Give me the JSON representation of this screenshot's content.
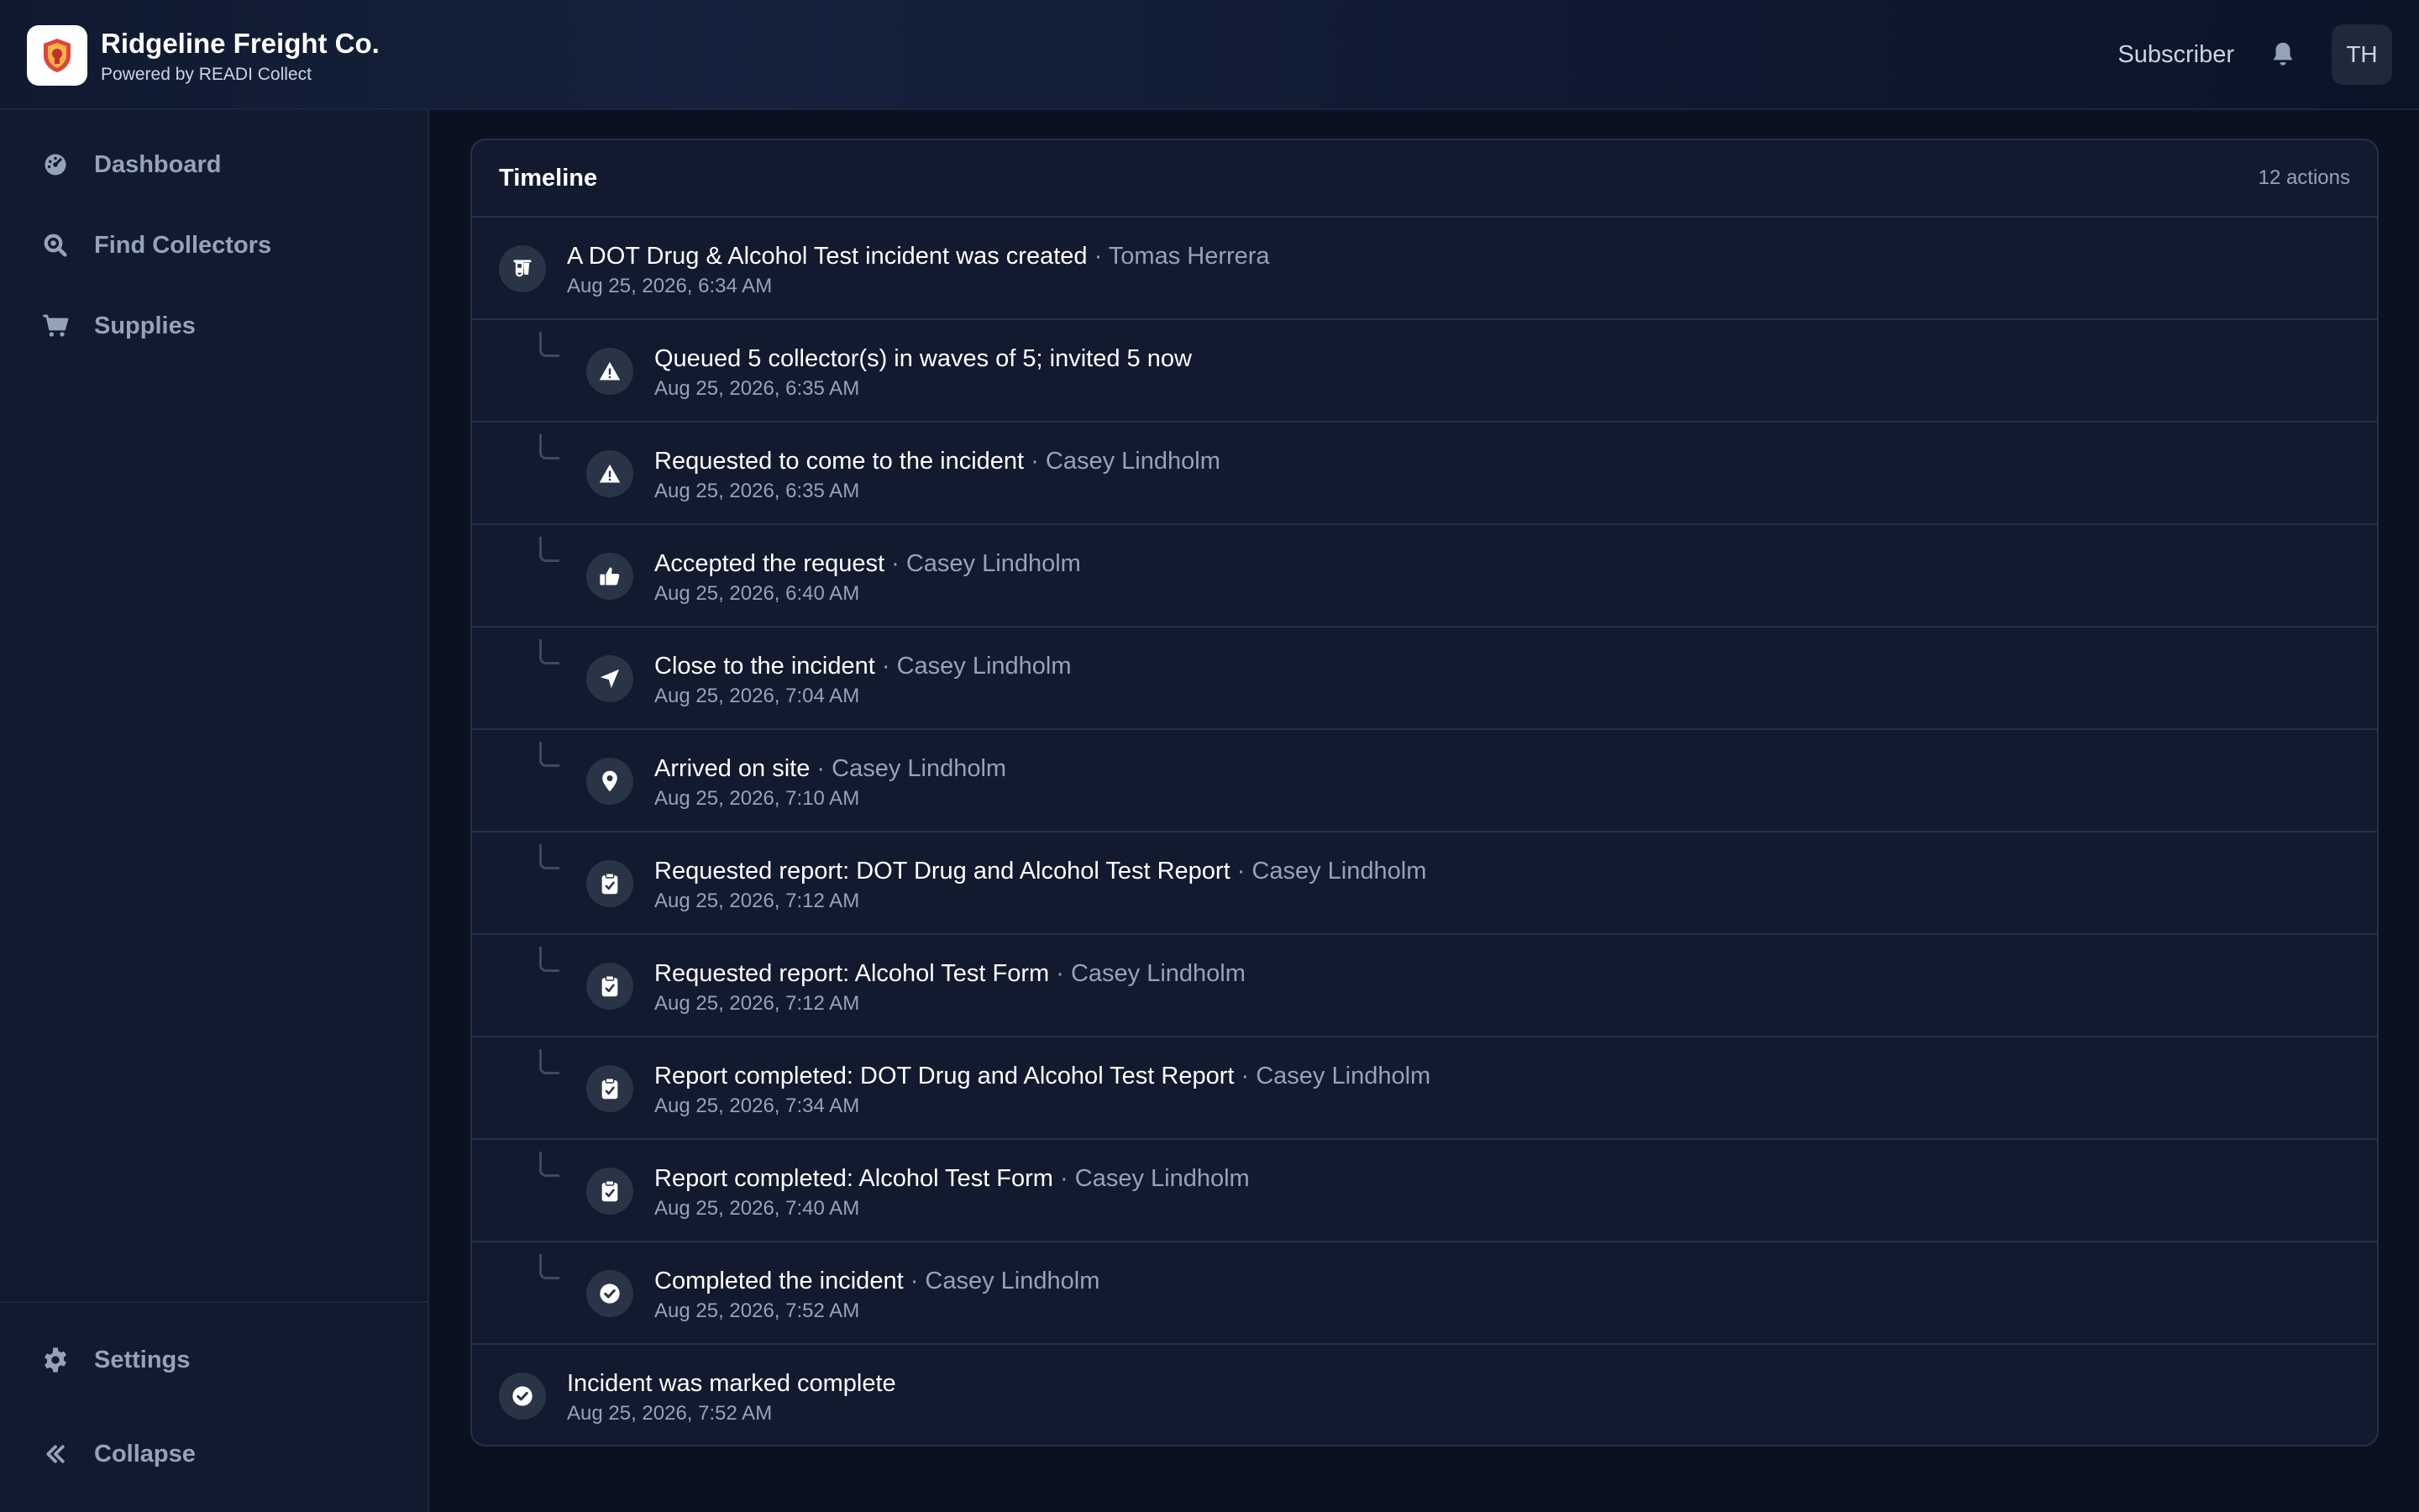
{
  "brand": {
    "name": "Ridgeline Freight Co.",
    "subtitle": "Powered by READI Collect",
    "logo_icon": "shield-badge-icon"
  },
  "header": {
    "role": "Subscriber",
    "avatar_initials": "TH",
    "bell_icon": "bell-icon"
  },
  "sidebar": {
    "items": [
      {
        "label": "Dashboard",
        "icon": "gauge-icon"
      },
      {
        "label": "Find Collectors",
        "icon": "search-icon"
      },
      {
        "label": "Supplies",
        "icon": "cart-icon"
      }
    ],
    "footer": [
      {
        "label": "Settings",
        "icon": "gear-icon"
      },
      {
        "label": "Collapse",
        "icon": "double-chevron-left-icon"
      }
    ]
  },
  "timeline": {
    "title": "Timeline",
    "count": "12 actions",
    "rows": [
      {
        "level": "top",
        "icon": "test-kit-icon",
        "text": "A DOT Drug & Alcohol Test incident was created",
        "actor": "Tomas Herrera",
        "time": "Aug 25, 2026, 6:34 AM"
      },
      {
        "level": "child",
        "icon": "warning-icon",
        "text": "Queued 5 collector(s) in waves of 5; invited 5 now",
        "actor": "",
        "time": "Aug 25, 2026, 6:35 AM"
      },
      {
        "level": "child",
        "icon": "warning-icon",
        "text": "Requested to come to the incident",
        "actor": "Casey Lindholm",
        "time": "Aug 25, 2026, 6:35 AM"
      },
      {
        "level": "child",
        "icon": "thumbs-up-icon",
        "text": "Accepted the request",
        "actor": "Casey Lindholm",
        "time": "Aug 25, 2026, 6:40 AM"
      },
      {
        "level": "child",
        "icon": "navigation-arrow-icon",
        "text": "Close to the incident",
        "actor": "Casey Lindholm",
        "time": "Aug 25, 2026, 7:04 AM"
      },
      {
        "level": "child",
        "icon": "map-pin-icon",
        "text": "Arrived on site",
        "actor": "Casey Lindholm",
        "time": "Aug 25, 2026, 7:10 AM"
      },
      {
        "level": "child",
        "icon": "clipboard-icon",
        "text": "Requested report: DOT Drug and Alcohol Test Report",
        "actor": "Casey Lindholm",
        "time": "Aug 25, 2026, 7:12 AM"
      },
      {
        "level": "child",
        "icon": "clipboard-icon",
        "text": "Requested report: Alcohol Test Form",
        "actor": "Casey Lindholm",
        "time": "Aug 25, 2026, 7:12 AM"
      },
      {
        "level": "child",
        "icon": "clipboard-icon",
        "text": "Report completed: DOT Drug and Alcohol Test Report",
        "actor": "Casey Lindholm",
        "time": "Aug 25, 2026, 7:34 AM"
      },
      {
        "level": "child",
        "icon": "clipboard-icon",
        "text": "Report completed: Alcohol Test Form",
        "actor": "Casey Lindholm",
        "time": "Aug 25, 2026, 7:40 AM"
      },
      {
        "level": "child",
        "icon": "check-circle-icon",
        "text": "Completed the incident",
        "actor": "Casey Lindholm",
        "time": "Aug 25, 2026, 7:52 AM"
      },
      {
        "level": "top",
        "icon": "check-circle-icon",
        "text": "Incident was marked complete",
        "actor": "",
        "time": "Aug 25, 2026, 7:52 AM"
      }
    ]
  }
}
